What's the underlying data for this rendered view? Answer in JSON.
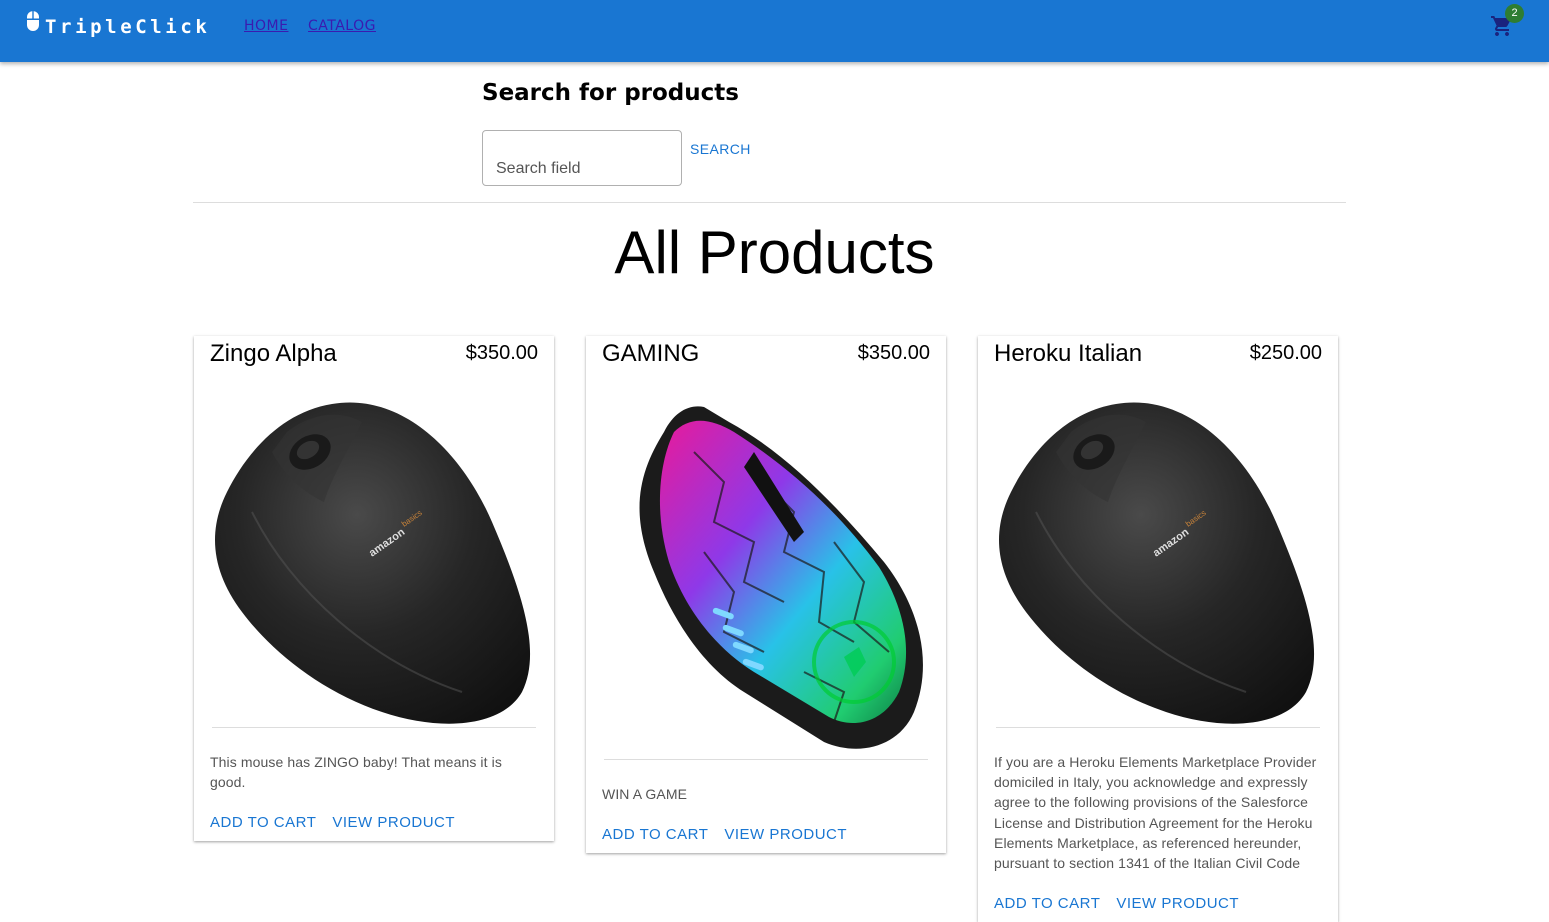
{
  "header": {
    "brand": "TripleClick",
    "nav": [
      {
        "label": "HOME"
      },
      {
        "label": "CATALOG"
      }
    ],
    "cart_count": "2",
    "brand_color": "#1976d2",
    "icons": {
      "logo": "mouse-icon",
      "cart": "shopping-cart-icon"
    }
  },
  "search": {
    "title": "Search for products",
    "placeholder": "Search field",
    "value": "",
    "button_label": "SEARCH"
  },
  "main": {
    "title": "All Products",
    "products": [
      {
        "name": "Zingo Alpha",
        "price": "$350.00",
        "image": "black-mouse-image",
        "brand_mark": "amazon",
        "brand_sub": "basics",
        "description": "This mouse has ZINGO baby! That means it is good.",
        "add_to_cart": "ADD TO CART",
        "view_product": "VIEW PRODUCT"
      },
      {
        "name": "GAMING",
        "price": "$350.00",
        "image": "gaming-mouse-image",
        "description": "WIN A GAME",
        "add_to_cart": "ADD TO CART",
        "view_product": "VIEW PRODUCT"
      },
      {
        "name": "Heroku Italian",
        "price": "$250.00",
        "image": "black-mouse-image",
        "brand_mark": "amazon",
        "brand_sub": "basics",
        "description": "If you are a Heroku Elements Marketplace Provider domiciled in Italy, you acknowledge and expressly agree to the following provisions of the Salesforce License and Distribution Agreement for the Heroku Elements Marketplace, as referenced hereunder, pursuant to section 1341 of the Italian Civil Code",
        "add_to_cart": "ADD TO CART",
        "view_product": "VIEW PRODUCT"
      }
    ]
  }
}
